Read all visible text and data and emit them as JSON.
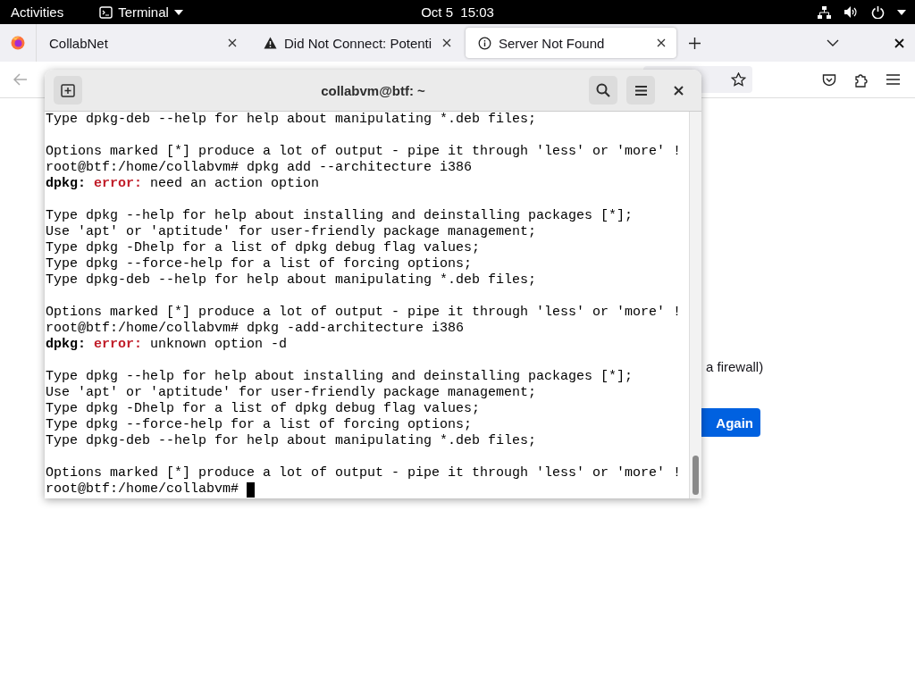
{
  "top_bar": {
    "activities": "Activities",
    "app_menu": "Terminal",
    "clock": "Oct 5  15:03"
  },
  "browser": {
    "tabs": [
      {
        "title": "CollabNet",
        "kind": "plain",
        "selected": false
      },
      {
        "title": "Did Not Connect: Potenti",
        "kind": "warning",
        "selected": false
      },
      {
        "title": "Server Not Found",
        "kind": "info",
        "selected": true
      }
    ],
    "page": {
      "text": "a firewall)",
      "button": "Again"
    }
  },
  "terminal": {
    "title": "collabvm@btf: ~",
    "lines": [
      {
        "kind": "text",
        "text": "Type dpkg-deb --help for help about manipulating *.deb files;"
      },
      {
        "kind": "blank"
      },
      {
        "kind": "text",
        "text": "Options marked [*] produce a lot of output - pipe it through 'less' or 'more' !"
      },
      {
        "kind": "text",
        "text": "root@btf:/home/collabvm# dpkg add --architecture i386"
      },
      {
        "kind": "error",
        "program": "dpkg:",
        "label": "error:",
        "message": "need an action option"
      },
      {
        "kind": "blank"
      },
      {
        "kind": "text",
        "text": "Type dpkg --help for help about installing and deinstalling packages [*];"
      },
      {
        "kind": "text",
        "text": "Use 'apt' or 'aptitude' for user-friendly package management;"
      },
      {
        "kind": "text",
        "text": "Type dpkg -Dhelp for a list of dpkg debug flag values;"
      },
      {
        "kind": "text",
        "text": "Type dpkg --force-help for a list of forcing options;"
      },
      {
        "kind": "text",
        "text": "Type dpkg-deb --help for help about manipulating *.deb files;"
      },
      {
        "kind": "blank"
      },
      {
        "kind": "text",
        "text": "Options marked [*] produce a lot of output - pipe it through 'less' or 'more' !"
      },
      {
        "kind": "text",
        "text": "root@btf:/home/collabvm# dpkg -add-architecture i386"
      },
      {
        "kind": "error",
        "program": "dpkg:",
        "label": "error:",
        "message": "unknown option -d"
      },
      {
        "kind": "blank"
      },
      {
        "kind": "text",
        "text": "Type dpkg --help for help about installing and deinstalling packages [*];"
      },
      {
        "kind": "text",
        "text": "Use 'apt' or 'aptitude' for user-friendly package management;"
      },
      {
        "kind": "text",
        "text": "Type dpkg -Dhelp for a list of dpkg debug flag values;"
      },
      {
        "kind": "text",
        "text": "Type dpkg --force-help for a list of forcing options;"
      },
      {
        "kind": "text",
        "text": "Type dpkg-deb --help for help about manipulating *.deb files;"
      },
      {
        "kind": "blank"
      },
      {
        "kind": "text",
        "text": "Options marked [*] produce a lot of output - pipe it through 'less' or 'more' !"
      },
      {
        "kind": "prompt",
        "text": "root@btf:/home/collabvm#",
        "cursor": true
      }
    ]
  }
}
